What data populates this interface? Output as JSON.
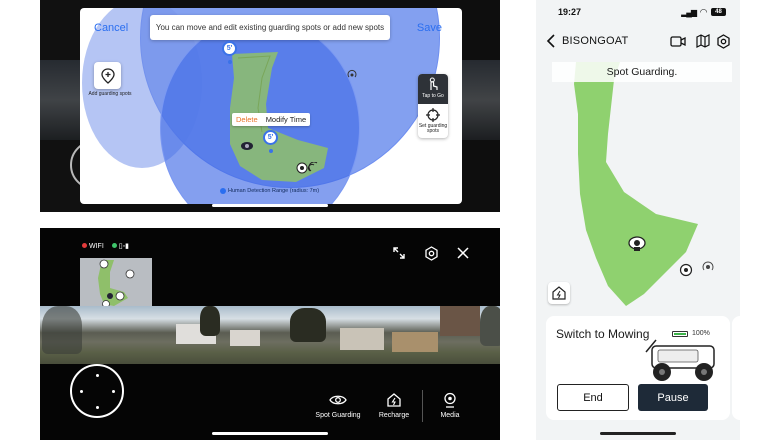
{
  "edit_screen": {
    "cancel_label": "Cancel",
    "save_label": "Save",
    "hint_text": "You can move and edit existing guarding spots or add new spots",
    "add_spot_label": "Add guarding spots",
    "tap_to_go_label": "Tap to Go",
    "set_spots_label": "Set guarding spots",
    "popup_delete": "Delete",
    "popup_modify": "Modify Time",
    "pin_top": "5'",
    "pin_mid": "5'",
    "detection_note": "Human Detection Range (radius: 7m)",
    "colors": {
      "accent": "#2a6ef0",
      "circle": "#5980eb",
      "lawn": "#8fbf6a",
      "delete": "#e8742b"
    }
  },
  "live_screen": {
    "wifi_label": "WIFI",
    "wifi_dot_color": "#e23b3b",
    "signal_dot_color": "#3ec46a",
    "actions": [
      {
        "icon": "eye-icon",
        "label": "Spot Guarding"
      },
      {
        "icon": "recharge-house-icon",
        "label": "Recharge"
      },
      {
        "icon": "camera-icon",
        "label": "Media"
      }
    ]
  },
  "phone": {
    "time": "19:27",
    "battery": "48",
    "title": "BISONGOAT",
    "banner": "Spot Guarding.",
    "mode_label": "Switch to Mowing",
    "battery_pct": "100%",
    "battery_level": 1.0,
    "end_label": "End",
    "pause_label": "Pause",
    "colors": {
      "lawn": "#8fd16f",
      "pause_bg": "#1e2a38"
    }
  }
}
